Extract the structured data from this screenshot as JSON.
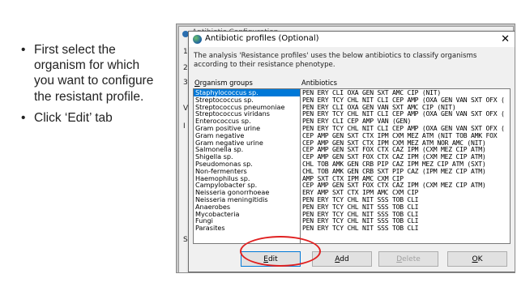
{
  "slide": {
    "bullets": [
      "First select the organism for which you want to configure the resistant profile.",
      "Click ‘Edit’ tab"
    ]
  },
  "background_window": {
    "title": "Antibiotic Configuration",
    "step_numbers": [
      "1.",
      "2.",
      "3."
    ],
    "fragments": [
      "V",
      "I",
      "S"
    ]
  },
  "dialog": {
    "title": "Antibiotic profiles (Optional)",
    "close_glyph": "✕",
    "description": "The analysis 'Resistance profiles' uses the below antibiotics to classify organisms according to their resistance phenotype.",
    "organism_groups_header_underlined": "O",
    "organism_groups_header_rest": "rganism groups",
    "antibiotics_header": "Antibiotics",
    "organism_groups": [
      "Staphylococcus sp.",
      "Streptococcus sp.",
      "Streptococcus pneumoniae",
      "Streptococcus viridans",
      "Enterococcus sp.",
      "Gram positive urine",
      "Gram negative",
      "Gram negative urine",
      "Salmonella sp.",
      "Shigella sp.",
      "Pseudomonas sp.",
      "Non-fermenters",
      "Haemophilus sp.",
      "Campylobacter sp.",
      "Neisseria gonorrhoeae",
      "Neisseria meningitidis",
      "Anaerobes",
      "Mycobacteria",
      "Fungi",
      "Parasites"
    ],
    "selected_index": 0,
    "antibiotics": [
      "PEN ERY CLI OXA GEN SXT AMC CIP (NIT)",
      "PEN ERY TCY CHL NIT CLI CEP AMP (OXA GEN VAN SXT OFX (",
      "PEN ERY CLI OXA GEN VAN SXT AMC CIP (NIT)",
      "PEN ERY TCY CHL NIT CLI CEP AMP (OXA GEN VAN SXT OFX (",
      "PEN ERY CLI CEP AMP VAN (GEN)",
      "PEN ERY TCY CHL NIT CLI CEP AMP (OXA GEN VAN SXT OFX (",
      "CEP AMP GEN SXT CTX IPM CXM MEZ ATM (NIT TOB AMK FOX",
      "CEP AMP GEN SXT CTX IPM CXM MEZ ATM NOR AMC (NIT)",
      "CEP AMP GEN SXT FOX CTX CAZ IPM (CXM MEZ CIP ATM)",
      "CEP AMP GEN SXT FOX CTX CAZ IPM (CXM MEZ CIP ATM)",
      "CHL TOB AMK GEN CRB PIP CAZ IPM MEZ CIP ATM (SXT)",
      "CHL TOB AMK GEN CRB SXT PIP CAZ (IPM MEZ CIP ATM)",
      "AMP SXT CTX IPM AMC CXM CIP",
      "CEP AMP GEN SXT FOX CTX CAZ IPM (CXM MEZ CIP ATM)",
      "ERY AMP SXT CTX IPM AMC CXM CIP",
      "PEN ERY TCY CHL NIT SSS TOB CLI",
      "PEN ERY TCY CHL NIT SSS TOB CLI",
      "PEN ERY TCY CHL NIT SSS TOB CLI",
      "PEN ERY TCY CHL NIT SSS TOB CLI",
      "PEN ERY TCY CHL NIT SSS TOB CLI"
    ],
    "buttons": {
      "edit": {
        "u": "E",
        "rest": "dit"
      },
      "add": {
        "u": "A",
        "rest": "dd"
      },
      "delete": {
        "u": "D",
        "rest": "elete"
      },
      "ok": {
        "u": "O",
        "rest": "K"
      }
    }
  },
  "colors": {
    "selection": "#0078d7",
    "highlight_ring": "#e02020"
  }
}
